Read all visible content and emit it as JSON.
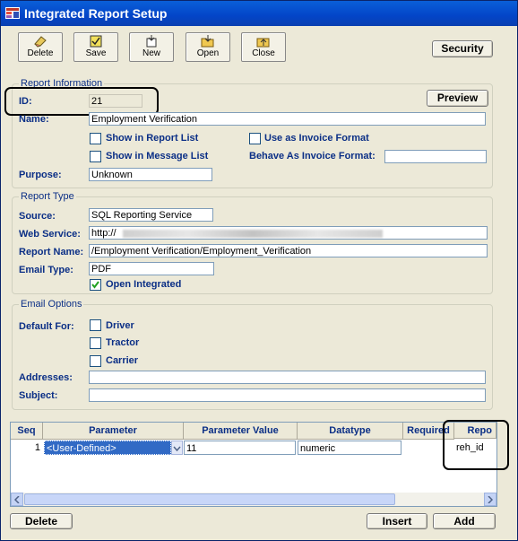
{
  "window": {
    "title": "Integrated Report Setup"
  },
  "toolbar": {
    "delete": "Delete",
    "save": "Save",
    "new": "New",
    "open": "Open",
    "close": "Close",
    "security": "Security"
  },
  "report_info": {
    "section": "Report Information",
    "id_label": "ID:",
    "id_value": "21",
    "preview": "Preview",
    "name_label": "Name:",
    "name_value": "Employment Verification",
    "show_in_report_list": "Show in Report List",
    "use_as_invoice_format": "Use as Invoice Format",
    "show_in_message_list": "Show in Message List",
    "behave_as_invoice_format": "Behave As Invoice Format:",
    "behave_as_invoice_value": "",
    "purpose_label": "Purpose:",
    "purpose_value": "Unknown"
  },
  "report_type": {
    "section": "Report Type",
    "source_label": "Source:",
    "source_value": "SQL Reporting Service",
    "web_service_label": "Web Service:",
    "web_service_value": "http://",
    "report_name_label": "Report Name:",
    "report_name_value": "/Employment Verification/Employment_Verification",
    "email_type_label": "Email Type:",
    "email_type_value": "PDF",
    "open_integrated": "Open Integrated"
  },
  "email_options": {
    "section": "Email Options",
    "default_for_label": "Default For:",
    "driver": "Driver",
    "tractor": "Tractor",
    "carrier": "Carrier",
    "addresses_label": "Addresses:",
    "addresses_value": "",
    "subject_label": "Subject:",
    "subject_value": ""
  },
  "grid": {
    "headers": [
      "Seq",
      "Parameter",
      "Parameter Value",
      "Datatype",
      "Required",
      "Repo"
    ],
    "rows": [
      {
        "seq": "1",
        "parameter": "<User-Defined>",
        "value": "11",
        "datatype": "numeric",
        "required": "",
        "report": "reh_id"
      }
    ]
  },
  "bottom": {
    "delete": "Delete",
    "insert": "Insert",
    "add": "Add"
  },
  "colors": {
    "accent": "#0b2f86",
    "titlebar": "#0345c8",
    "selected": "#316ac5"
  }
}
